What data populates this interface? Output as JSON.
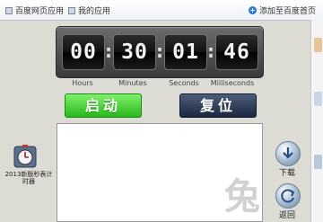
{
  "topbar": {
    "home_label": "百度网页应用",
    "mine_label": "我的应用",
    "add_label": "添加至百度首页"
  },
  "timer": {
    "hours": "00",
    "minutes": "30",
    "seconds": "01",
    "milliseconds": "46",
    "label_hours": "Hours",
    "label_minutes": "Minutes",
    "label_seconds": "Seconds",
    "label_milliseconds": "Milliseconds"
  },
  "buttons": {
    "start": "启动",
    "reset": "复位"
  },
  "app": {
    "label": "2013新版秒表计时器"
  },
  "side": {
    "download": "下载",
    "back": "返回"
  },
  "watermark": "兔"
}
